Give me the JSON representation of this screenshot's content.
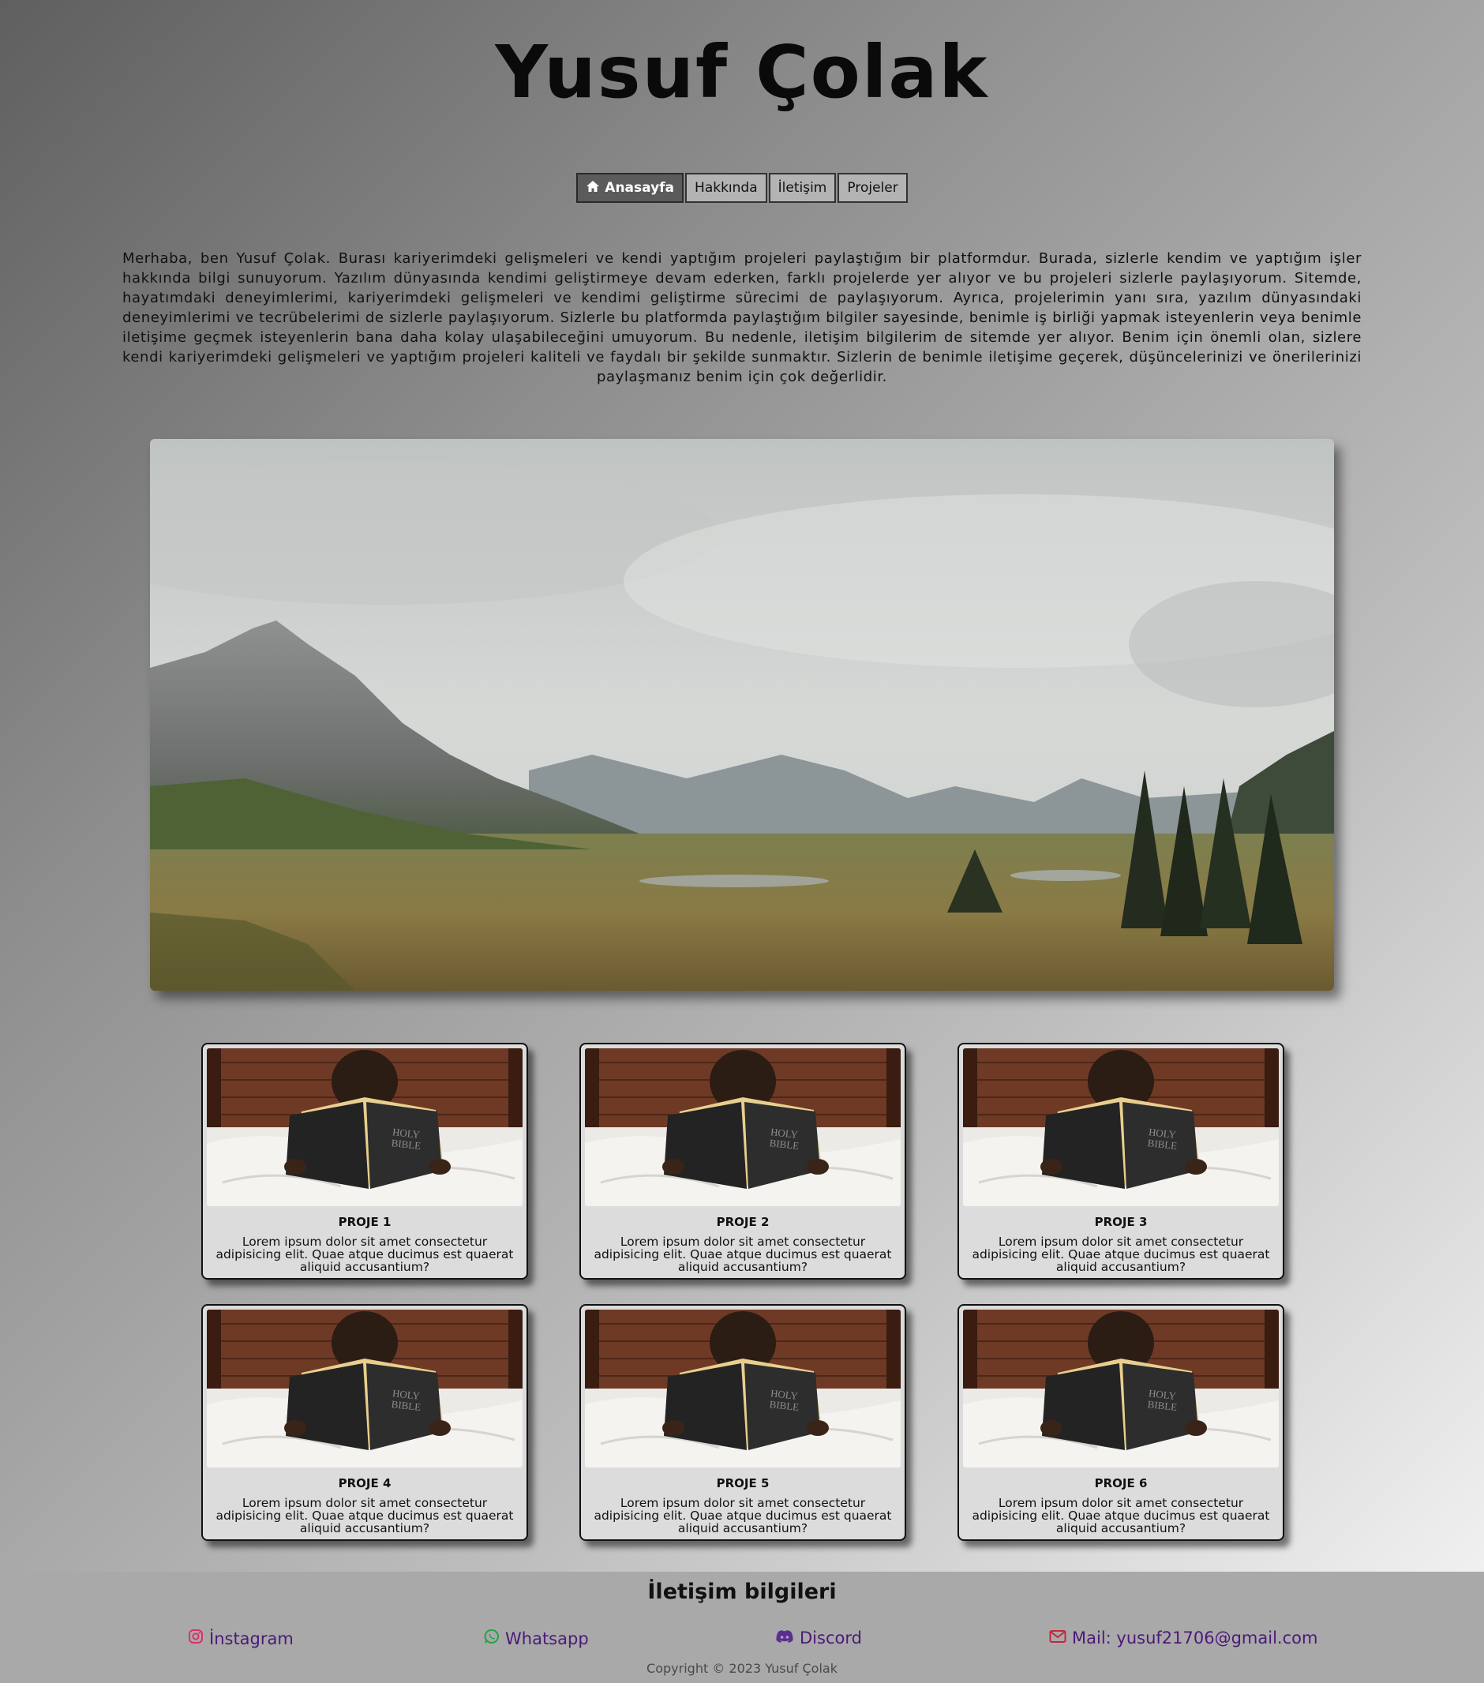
{
  "header": {
    "title": "Yusuf Çolak"
  },
  "nav": {
    "items": [
      {
        "label": "Anasayfa",
        "icon": "home-icon",
        "active": true
      },
      {
        "label": "Hakkında"
      },
      {
        "label": "İletişim"
      },
      {
        "label": "Projeler"
      }
    ]
  },
  "intro": {
    "text": "Merhaba, ben Yusuf Çolak. Burası kariyerimdeki gelişmeleri ve kendi yaptığım projeleri paylaştığım bir platformdur. Burada, sizlerle kendim ve yaptığım işler hakkında bilgi sunuyorum. Yazılım dünyasında kendimi geliştirmeye devam ederken, farklı projelerde yer alıyor ve bu projeleri sizlerle paylaşıyorum. Sitemde, hayatımdaki deneyimlerimi, kariyerimdeki gelişmeleri ve kendimi geliştirme sürecimi de paylaşıyorum. Ayrıca, projelerimin yanı sıra, yazılım dünyasındaki deneyimlerimi ve tecrübelerimi de sizlerle paylaşıyorum. Sizlerle bu platformda paylaştığım bilgiler sayesinde, benimle iş birliği yapmak isteyenlerin veya benimle iletişime geçmek isteyenlerin bana daha kolay ulaşabileceğini umuyorum. Bu nedenle, iletişim bilgilerim de sitemde yer alıyor. Benim için önemli olan, sizlere kendi kariyerimdeki gelişmeleri ve yaptığım projeleri kaliteli ve faydalı bir şekilde sunmaktır. Sizlerin de benimle iletişime geçerek, düşüncelerinizi ve önerilerinizi paylaşmanız benim için çok değerlidir."
  },
  "projects": [
    {
      "title": "PROJE 1",
      "desc": "Lorem ipsum dolor sit amet consectetur adipisicing elit. Quae atque ducimus est quaerat aliquid accusantium?"
    },
    {
      "title": "PROJE 2",
      "desc": "Lorem ipsum dolor sit amet consectetur adipisicing elit. Quae atque ducimus est quaerat aliquid accusantium?"
    },
    {
      "title": "PROJE 3",
      "desc": "Lorem ipsum dolor sit amet consectetur adipisicing elit. Quae atque ducimus est quaerat aliquid accusantium?"
    },
    {
      "title": "PROJE 4",
      "desc": "Lorem ipsum dolor sit amet consectetur adipisicing elit. Quae atque ducimus est quaerat aliquid accusantium?"
    },
    {
      "title": "PROJE 5",
      "desc": "Lorem ipsum dolor sit amet consectetur adipisicing elit. Quae atque ducimus est quaerat aliquid accusantium?"
    },
    {
      "title": "PROJE 6",
      "desc": "Lorem ipsum dolor sit amet consectetur adipisicing elit. Quae atque ducimus est quaerat aliquid accusantium?"
    }
  ],
  "project_image": {
    "book_line1": "HOLY",
    "book_line2": "BIBLE"
  },
  "footer": {
    "title": "İletişim bilgileri",
    "contacts": [
      {
        "label": "İnstagram",
        "icon": "instagram-icon",
        "color": "#d6336c"
      },
      {
        "label": "Whatsapp",
        "icon": "whatsapp-icon",
        "color": "#25a244"
      },
      {
        "label": "Discord",
        "icon": "discord-icon",
        "color": "#5a2d91"
      },
      {
        "label": "Mail: yusuf21706@gmail.com",
        "icon": "mail-icon",
        "color": "#c0283f"
      }
    ],
    "copyright": "Copyright © 2023 Yusuf Çolak"
  },
  "colors": {
    "nav_active_bg": "#5b5b5b",
    "card_bg": "#dcdcdc",
    "footer_bg": "#a9a9a9",
    "link_color": "#4b1a78"
  }
}
